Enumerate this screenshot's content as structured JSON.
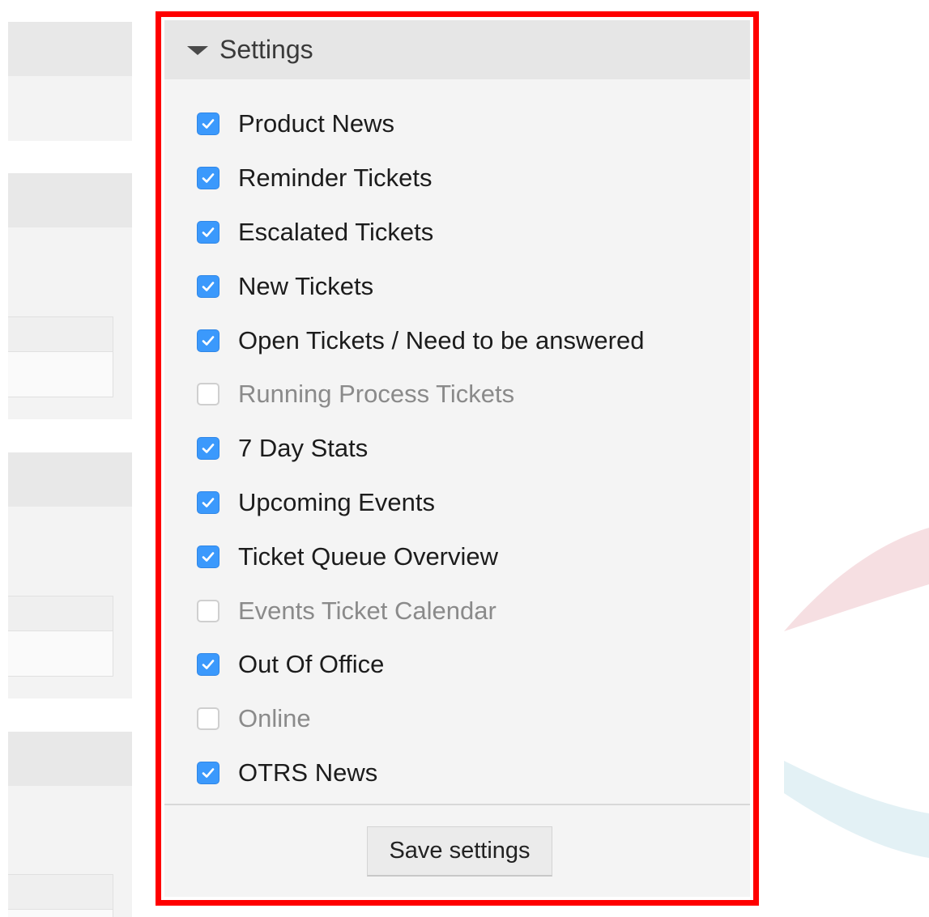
{
  "panel": {
    "title": "Settings",
    "save_label": "Save settings"
  },
  "items": [
    {
      "label": "Product News",
      "checked": true
    },
    {
      "label": "Reminder Tickets",
      "checked": true
    },
    {
      "label": "Escalated Tickets",
      "checked": true
    },
    {
      "label": "New Tickets",
      "checked": true
    },
    {
      "label": "Open Tickets / Need to be answered",
      "checked": true
    },
    {
      "label": "Running Process Tickets",
      "checked": false
    },
    {
      "label": "7 Day Stats",
      "checked": true
    },
    {
      "label": "Upcoming Events",
      "checked": true
    },
    {
      "label": "Ticket Queue Overview",
      "checked": true
    },
    {
      "label": "Events Ticket Calendar",
      "checked": false
    },
    {
      "label": "Out Of Office",
      "checked": true
    },
    {
      "label": "Online",
      "checked": false
    },
    {
      "label": "OTRS News",
      "checked": true
    }
  ],
  "colors": {
    "highlight": "#ff0000",
    "checkbox_checked": "#3b99fc",
    "label_enabled": "#1c1c1c",
    "label_disabled": "#8a8a8a"
  },
  "icons": {
    "collapse": "caret-down-icon",
    "check": "checkmark-icon"
  }
}
